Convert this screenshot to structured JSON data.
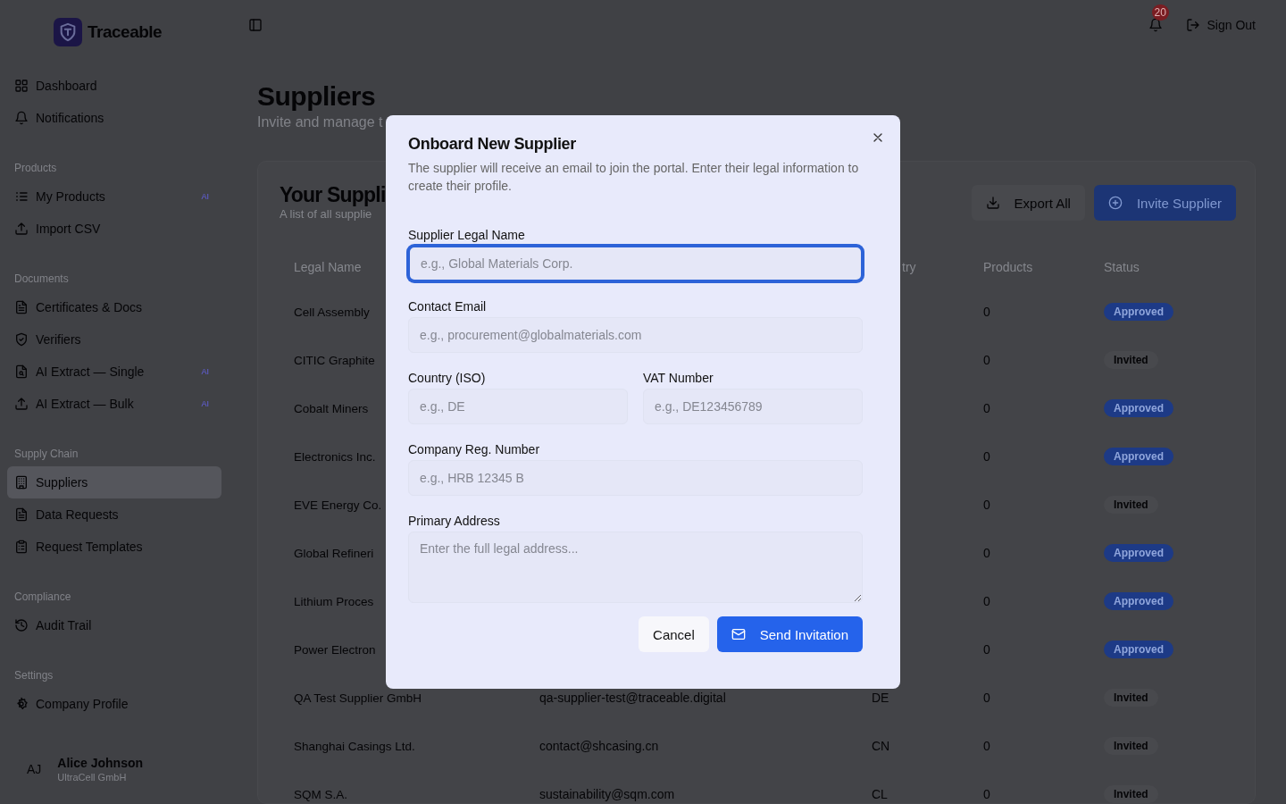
{
  "brand": {
    "name": "Traceable"
  },
  "topbar": {
    "notification_count": "20",
    "sign_out": "Sign Out"
  },
  "sidebar": {
    "groups": [
      {
        "items": [
          {
            "label": "Dashboard",
            "kind": "grid",
            "selected": false
          },
          {
            "label": "Notifications",
            "kind": "bell",
            "selected": false
          }
        ]
      },
      {
        "label": "Products",
        "items": [
          {
            "label": "My Products",
            "kind": "list",
            "badge": "AI",
            "selected": false
          },
          {
            "label": "Import CSV",
            "kind": "upload",
            "selected": false
          }
        ]
      },
      {
        "label": "Documents",
        "items": [
          {
            "label": "Certificates & Docs",
            "kind": "doc",
            "selected": false
          },
          {
            "label": "Verifiers",
            "kind": "shield",
            "selected": false
          },
          {
            "label": "AI Extract — Single",
            "kind": "docsearch",
            "badge": "AI",
            "selected": false
          },
          {
            "label": "AI Extract — Bulk",
            "kind": "upload",
            "badge": "AI",
            "selected": false
          }
        ]
      },
      {
        "label": "Supply Chain",
        "items": [
          {
            "label": "Suppliers",
            "kind": "building",
            "selected": true
          },
          {
            "label": "Data Requests",
            "kind": "doc",
            "selected": false
          },
          {
            "label": "Request Templates",
            "kind": "clipboard",
            "selected": false
          }
        ]
      },
      {
        "label": "Compliance",
        "items": [
          {
            "label": "Audit Trail",
            "kind": "history",
            "selected": false
          }
        ]
      },
      {
        "label": "Settings",
        "items": [
          {
            "label": "Company Profile",
            "kind": "gear",
            "selected": false
          }
        ]
      }
    ],
    "user": {
      "initials": "AJ",
      "name": "Alice Johnson",
      "company": "UltraCell GmbH"
    }
  },
  "page": {
    "title": "Suppliers",
    "subtitle": "Invite and manage t"
  },
  "card": {
    "title": "Your Suppli",
    "subtitle": "A list of all supplie",
    "export_button": "Export All",
    "invite_button": "Invite Supplier",
    "table": {
      "columns": [
        {
          "label": "Legal Name",
          "kind": "name"
        },
        {
          "label": "try",
          "kind": "country"
        },
        {
          "label": "Products",
          "kind": "products"
        },
        {
          "label": "Status",
          "kind": "status"
        }
      ],
      "rows": [
        {
          "name": "Cell Assembly",
          "products": "0",
          "status": "Approved",
          "kind": "approved"
        },
        {
          "name": "CITIC Graphite",
          "products": "0",
          "status": "Invited",
          "kind": "invited"
        },
        {
          "name": "Cobalt Miners",
          "products": "0",
          "status": "Approved",
          "kind": "approved"
        },
        {
          "name": "Electronics Inc.",
          "products": "0",
          "status": "Approved",
          "kind": "approved"
        },
        {
          "name": "EVE Energy Co.",
          "products": "0",
          "status": "Invited",
          "kind": "invited"
        },
        {
          "name": "Global Refineri",
          "products": "0",
          "status": "Approved",
          "kind": "approved"
        },
        {
          "name": "Lithium Proces",
          "products": "0",
          "status": "Approved",
          "kind": "approved"
        },
        {
          "name": "Power Electron",
          "products": "0",
          "status": "Approved",
          "kind": "approved"
        },
        {
          "name": "QA Test Supplier GmbH",
          "email": "qa-supplier-test@traceable.digital",
          "country": "DE",
          "products": "0",
          "status": "Invited",
          "kind": "invited"
        },
        {
          "name": "Shanghai Casings Ltd.",
          "email": "contact@shcasing.cn",
          "country": "CN",
          "products": "0",
          "status": "Invited",
          "kind": "invited"
        },
        {
          "name": "SQM S.A.",
          "email": "sustainability@sqm.com",
          "country": "CL",
          "products": "0",
          "status": "Invited",
          "kind": "invited"
        }
      ]
    }
  },
  "dialog": {
    "title": "Onboard New Supplier",
    "description": "The supplier will receive an email to join the portal. Enter their legal information to create their profile.",
    "fields": [
      {
        "label": "Supplier Legal Name",
        "placeholder": "e.g., Global Materials Corp.",
        "focused": true,
        "kind": "input"
      },
      {
        "label": "Contact Email",
        "placeholder": "e.g., procurement@globalmaterials.com",
        "focused": false,
        "kind": "input"
      },
      {
        "label": "Country (ISO)",
        "placeholder": "e.g., DE",
        "focused": false,
        "kind": "half"
      },
      {
        "label": "VAT Number",
        "placeholder": "e.g., DE123456789",
        "focused": false,
        "kind": "half"
      },
      {
        "label": "Company Reg. Number",
        "placeholder": "e.g., HRB 12345 B",
        "focused": false,
        "kind": "input"
      },
      {
        "label": "Primary Address",
        "placeholder": "Enter the full legal address...",
        "focused": false,
        "kind": "textarea"
      }
    ],
    "cancel_button": "Cancel",
    "submit_button": "Send Invitation"
  }
}
